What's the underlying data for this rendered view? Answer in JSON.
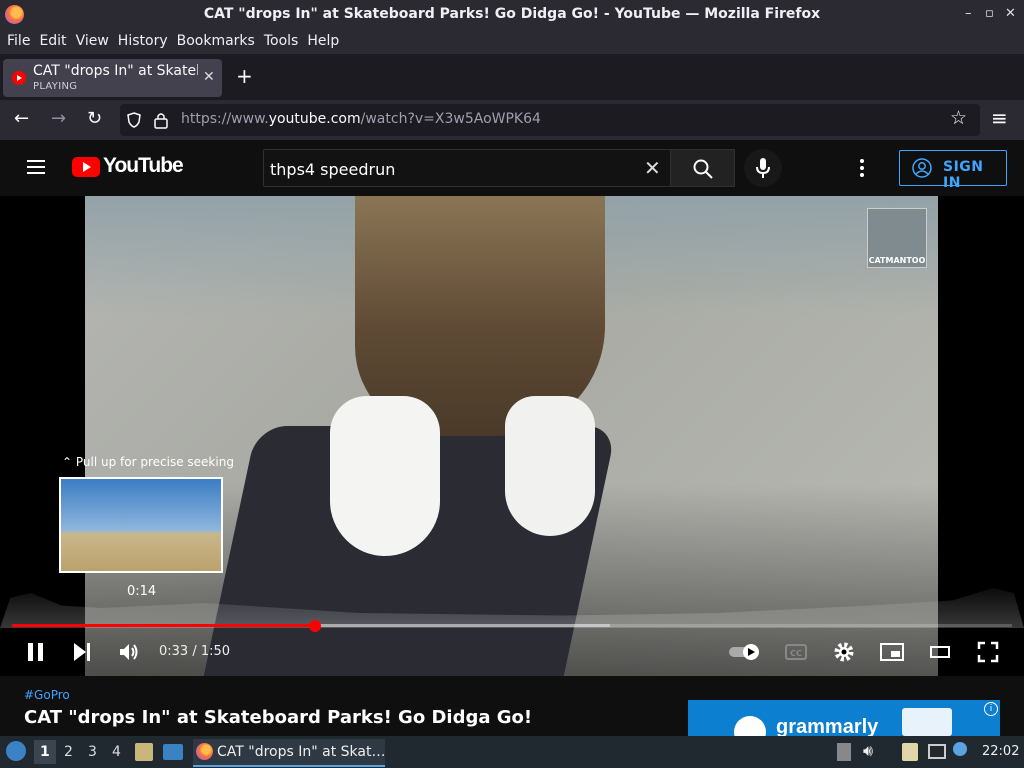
{
  "window": {
    "title": "CAT \"drops In\" at Skateboard Parks! Go Didga Go! - YouTube — Mozilla Firefox",
    "controls": [
      "–",
      "▫",
      "✕"
    ]
  },
  "menu": [
    "File",
    "Edit",
    "View",
    "History",
    "Bookmarks",
    "Tools",
    "Help"
  ],
  "tab": {
    "title": "CAT \"drops In\" at Skateboard",
    "status": "PLAYING",
    "close": "✕",
    "new_tab": "+"
  },
  "navbar": {
    "back": "←",
    "forward": "→",
    "reload": "↻",
    "url_prefix": "https://www.",
    "url_domain": "youtube.com",
    "url_path": "/watch?v=X3w5AoWPK64",
    "bookmark_star": "☆",
    "menu": "≡"
  },
  "youtube": {
    "logo_text": "YouTube",
    "search_value": "thps4 speedrun",
    "clear": "✕",
    "sign_in": "SIGN IN"
  },
  "player": {
    "watermark": "CATMANTOO",
    "seek_hint": "Pull up for precise seeking",
    "preview_time": "0:14",
    "current_time": "0:33",
    "duration": "1:50",
    "progress_fraction": 0.303,
    "buffered_fraction": 0.598
  },
  "video": {
    "hashtag": "#GoPro",
    "title": "CAT \"drops In\" at Skateboard Parks! Go Didga Go!",
    "ad_text": "grammarly"
  },
  "taskbar": {
    "workspaces": [
      "1",
      "2",
      "3",
      "4"
    ],
    "active_task": "CAT \"drops In\" at Skat…",
    "clock": "22:02"
  },
  "colors": {
    "accent_red": "#ff0000",
    "youtube_blue": "#3ea6ff"
  }
}
